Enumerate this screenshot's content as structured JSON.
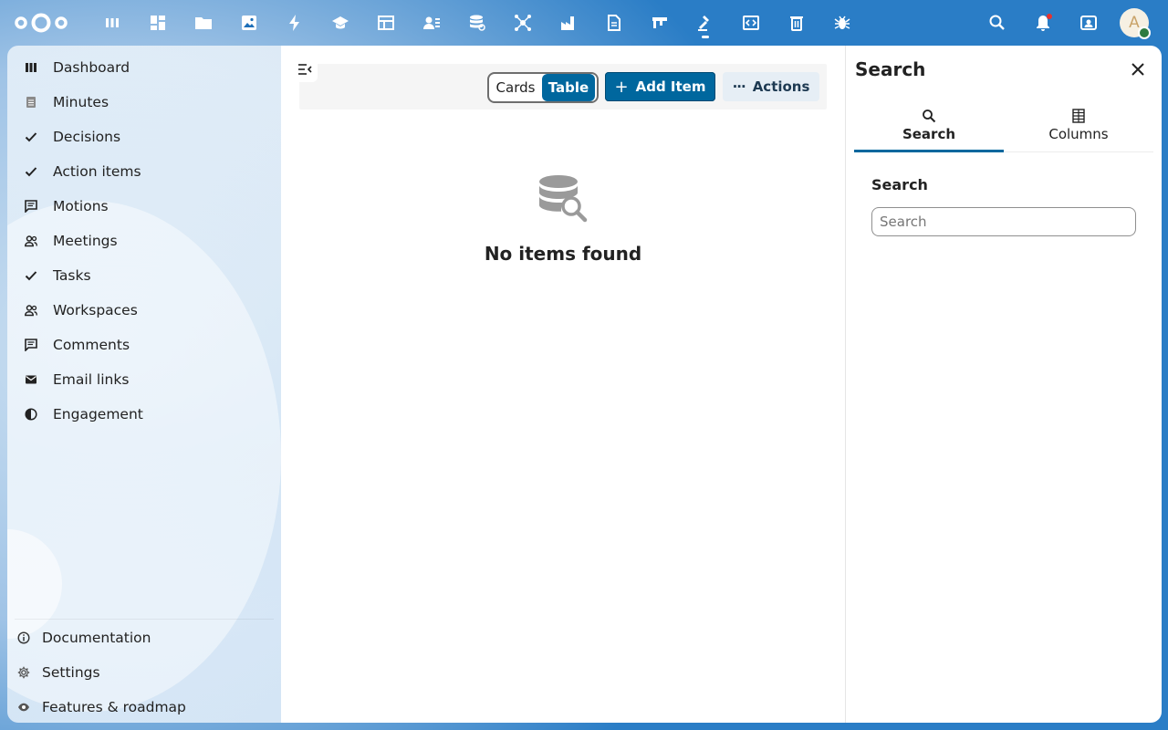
{
  "colors": {
    "primary": "#00679e",
    "header_bg": "#1d6fb8"
  },
  "topbar": {
    "apps": [
      {
        "icon": "dashboard-icon"
      },
      {
        "icon": "apps-grid-icon"
      },
      {
        "icon": "files-icon"
      },
      {
        "icon": "photos-icon"
      },
      {
        "icon": "activity-icon"
      },
      {
        "icon": "learning-icon"
      },
      {
        "icon": "spreadsheet-icon"
      },
      {
        "icon": "contacts-icon"
      },
      {
        "icon": "database-icon"
      },
      {
        "icon": "network-icon"
      },
      {
        "icon": "factory-icon"
      },
      {
        "icon": "document-icon"
      },
      {
        "icon": "board-icon"
      },
      {
        "icon": "gavel-icon",
        "active": true
      },
      {
        "icon": "code-icon"
      },
      {
        "icon": "trash-icon"
      },
      {
        "icon": "bug-icon"
      }
    ],
    "avatar_initial": "A"
  },
  "sidebar": {
    "items": [
      {
        "label": "Dashboard",
        "icon": "dashboard-icon"
      },
      {
        "label": "Minutes",
        "icon": "minutes-icon"
      },
      {
        "label": "Decisions",
        "icon": "check-icon"
      },
      {
        "label": "Action items",
        "icon": "check-icon"
      },
      {
        "label": "Motions",
        "icon": "comment-icon"
      },
      {
        "label": "Meetings",
        "icon": "people-icon"
      },
      {
        "label": "Tasks",
        "icon": "check-icon"
      },
      {
        "label": "Workspaces",
        "icon": "people-icon"
      },
      {
        "label": "Comments",
        "icon": "comment-icon"
      },
      {
        "label": "Email links",
        "icon": "email-icon"
      },
      {
        "label": "Engagement",
        "icon": "engagement-icon"
      }
    ],
    "bottom": [
      {
        "label": "Documentation",
        "icon": "info-icon"
      },
      {
        "label": "Settings",
        "icon": "gear-icon"
      },
      {
        "label": "Features & roadmap",
        "icon": "eye-icon"
      }
    ]
  },
  "main": {
    "view_toggle": {
      "cards": "Cards",
      "table": "Table",
      "selected": "Table"
    },
    "add_label": "Add Item",
    "actions_label": "Actions",
    "empty_title": "No items found"
  },
  "panel": {
    "title": "Search",
    "tabs": [
      {
        "label": "Search",
        "icon": "search-icon",
        "active": true
      },
      {
        "label": "Columns",
        "icon": "columns-icon"
      }
    ],
    "section_label": "Search",
    "search_placeholder": "Search",
    "search_value": ""
  }
}
